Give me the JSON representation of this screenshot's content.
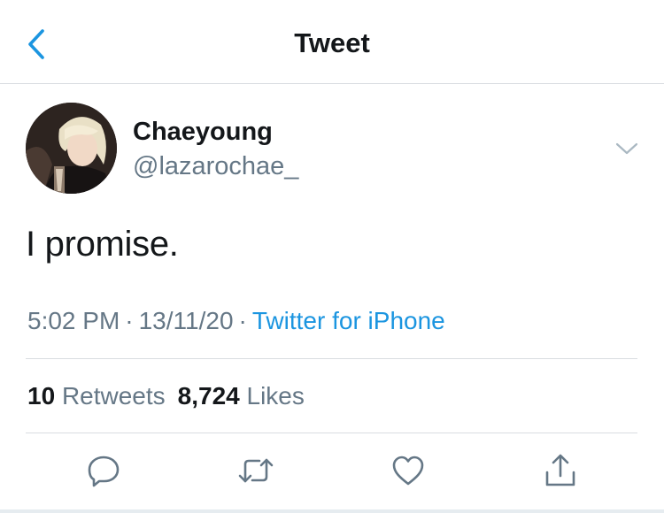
{
  "nav": {
    "title": "Tweet",
    "back_icon": "chevron-left-icon"
  },
  "tweet": {
    "author": {
      "name": "Chaeyoung",
      "handle": "@lazarochae_"
    },
    "text": "I promise.",
    "time": "5:02 PM",
    "date": "13/11/20",
    "source": "Twitter for iPhone",
    "stats": {
      "retweets_count": "10",
      "retweets_label": "Retweets",
      "likes_count": "8,724",
      "likes_label": "Likes"
    },
    "actions": [
      "reply-icon",
      "retweet-icon",
      "like-icon",
      "share-icon"
    ]
  },
  "colors": {
    "accent": "#1b95e0",
    "primary_text": "#14171a",
    "secondary_text": "#657786",
    "divider": "#d9dde1"
  }
}
